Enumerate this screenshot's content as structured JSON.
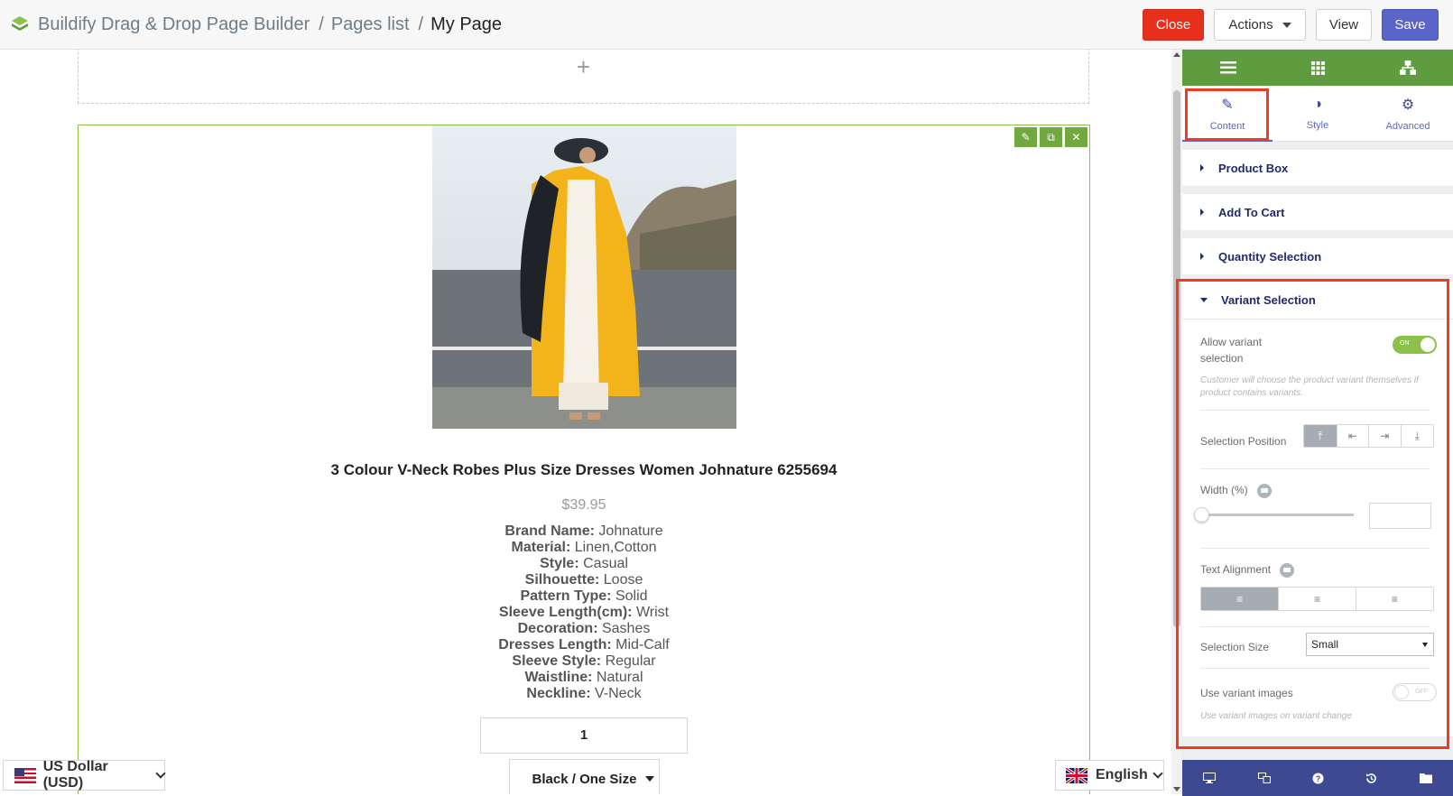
{
  "header": {
    "app_title": "Buildify Drag & Drop Page Builder",
    "breadcrumb_separator": "/",
    "breadcrumb_pages": "Pages list",
    "breadcrumb_current": "My Page",
    "close_label": "Close",
    "actions_label": "Actions",
    "view_label": "View",
    "save_label": "Save"
  },
  "canvas": {
    "add_section_symbol": "+",
    "product": {
      "title": "3 Colour V-Neck Robes Plus Size Dresses Women Johnature 6255694",
      "price": "$39.95",
      "specs": [
        {
          "label": "Brand Name:",
          "value": "Johnature"
        },
        {
          "label": "Material:",
          "value": "Linen,Cotton"
        },
        {
          "label": "Style:",
          "value": "Casual"
        },
        {
          "label": "Silhouette:",
          "value": "Loose"
        },
        {
          "label": "Pattern Type:",
          "value": "Solid"
        },
        {
          "label": "Sleeve Length(cm):",
          "value": "Wrist"
        },
        {
          "label": "Decoration:",
          "value": "Sashes"
        },
        {
          "label": "Dresses Length:",
          "value": "Mid-Calf"
        },
        {
          "label": "Sleeve Style:",
          "value": "Regular"
        },
        {
          "label": "Waistline:",
          "value": "Natural"
        },
        {
          "label": "Neckline:",
          "value": "V-Neck"
        }
      ],
      "quantity": "1",
      "variant": "Black / One Size"
    },
    "currency": "US Dollar (USD)",
    "language": "English"
  },
  "panel": {
    "tabs": [
      {
        "label": "Content",
        "icon": "pencil-icon"
      },
      {
        "label": "Style",
        "icon": "contrast-icon"
      },
      {
        "label": "Advanced",
        "icon": "gear-icon"
      }
    ],
    "sections": [
      "Product Box",
      "Add To Cart",
      "Quantity Selection"
    ],
    "variant_section": {
      "title": "Variant Selection",
      "allow_label_line1": "Allow variant",
      "allow_label_line2": "selection",
      "allow_toggle": "ON",
      "allow_desc": "Customer will choose the product variant themselves if product contains variants.",
      "position_label": "Selection Position",
      "width_label": "Width (%)",
      "width_value": 0,
      "align_label": "Text Alignment",
      "size_label": "Selection Size",
      "size_value": "Small",
      "use_images_label": "Use variant images",
      "use_images_toggle": "OFF",
      "use_images_desc": "Use variant images on variant change"
    }
  },
  "colors": {
    "close": "#e5301b",
    "save": "#5b64c9",
    "panel_green": "#5f9b3f",
    "panel_footer": "#3d4a92",
    "highlight": "#f13a1f",
    "toggle_on": "#8cc04a"
  }
}
